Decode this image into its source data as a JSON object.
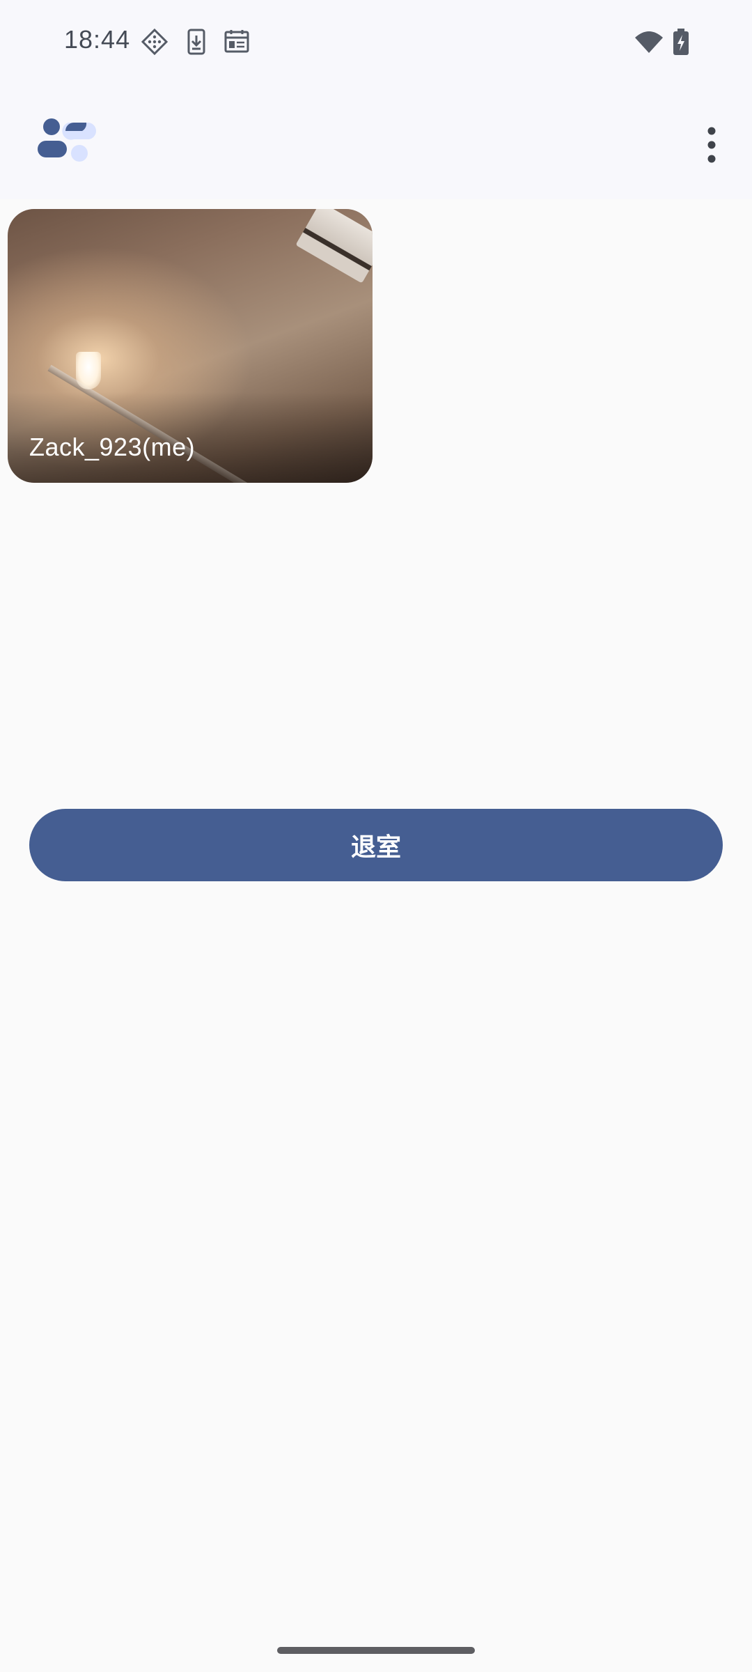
{
  "status_bar": {
    "time": "18:44",
    "icons": [
      "game-controller-icon",
      "download-icon",
      "calendar-icon",
      "wifi-icon",
      "battery-charging-icon"
    ]
  },
  "app_bar": {
    "logo_icon": "app-logo-icon",
    "menu_icon": "more-vert-icon"
  },
  "participants": [
    {
      "name": "Zack_923(me)"
    }
  ],
  "actions": {
    "leave_label": "退室"
  },
  "colors": {
    "primary": "#455e92",
    "logo_light": "#d9e2ff",
    "background": "#fafafa"
  }
}
